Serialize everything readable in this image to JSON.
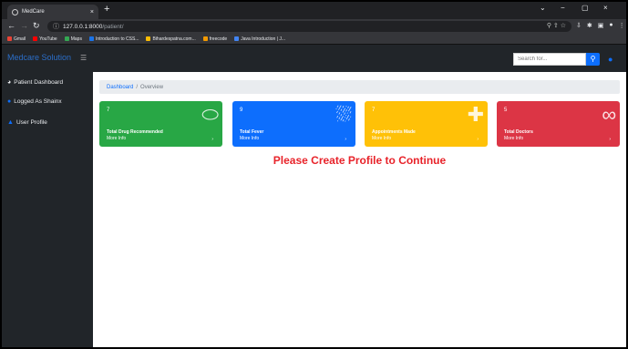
{
  "browser": {
    "tab_title": "MedCare",
    "tab_close": "×",
    "new_tab": "+",
    "url_host": "127.0.0.1:8000",
    "url_path": "/patient/",
    "window_controls": [
      "⌄",
      "−",
      "▢",
      "×"
    ],
    "bookmarks": [
      {
        "label": "Gmail",
        "color": "#ea4335"
      },
      {
        "label": "YouTube",
        "color": "#ff0000"
      },
      {
        "label": "Maps",
        "color": "#34a853"
      },
      {
        "label": "Introduction to CSS...",
        "color": "#1a73e8"
      },
      {
        "label": "Bihardespatna.com...",
        "color": "#fbbc04"
      },
      {
        "label": "freecode",
        "color": "#f29900"
      },
      {
        "label": "Java Introduction | J...",
        "color": "#4285f4"
      }
    ]
  },
  "navbar": {
    "brand": "Medcare Solution",
    "search_placeholder": "Search for...",
    "search_icon": "search-icon",
    "user_icon": "user-icon"
  },
  "sidebar": {
    "items": [
      {
        "label": "Patient Dashboard",
        "icon": "dashboard-icon"
      },
      {
        "label": "Logged As Shainx",
        "icon": "user-circle-icon"
      },
      {
        "label": "User Profile",
        "icon": "user-icon"
      }
    ]
  },
  "breadcrumb": {
    "link": "Dashboard",
    "separator": "/",
    "active": "Overview"
  },
  "cards": [
    {
      "value": "7",
      "title": "Total Drug Recommended",
      "more": "More Info",
      "arrow": "›",
      "color": "#28a745",
      "icon": "pills-icon"
    },
    {
      "value": "9",
      "title": "Total Fever",
      "more": "More Info",
      "arrow": "›",
      "color": "#0d6efd",
      "icon": "bed-icon"
    },
    {
      "value": "7",
      "title": "Appointments Made",
      "more": "More Info",
      "arrow": "›",
      "color": "#ffc107",
      "icon": "medical-file-icon"
    },
    {
      "value": "5",
      "title": "Total Doctors",
      "more": "More Info",
      "arrow": "›",
      "color": "#dc3545",
      "icon": "stethoscope-icon"
    }
  ],
  "notice": "Please Create Profile to Continue"
}
